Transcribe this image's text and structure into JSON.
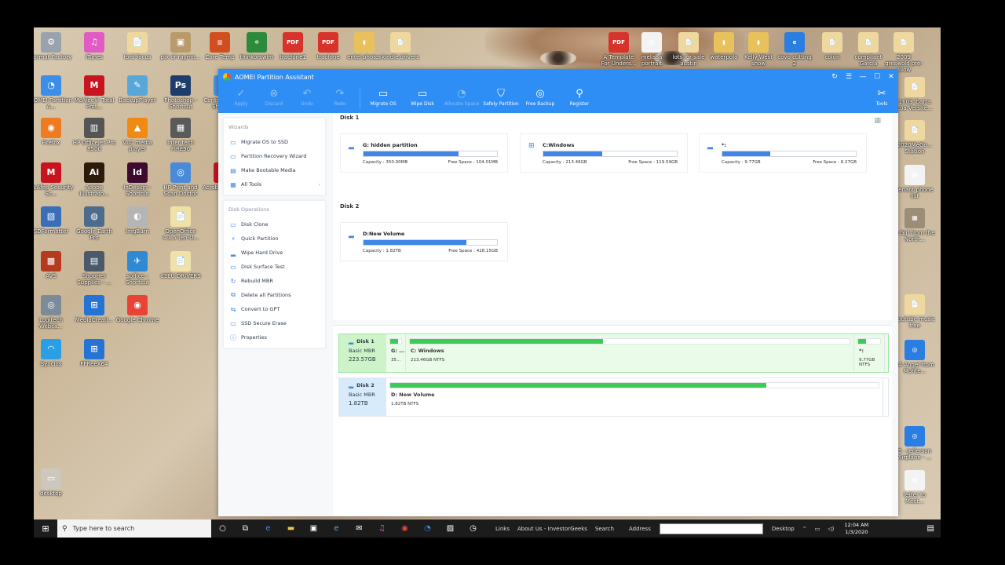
{
  "desktop": {
    "icons_left": [
      {
        "label": "Format Factory",
        "color": "#9aa3ad",
        "glyph": "⚙"
      },
      {
        "label": "iTunes",
        "color": "#e05bc3",
        "glyph": "♫"
      },
      {
        "label": "ford focus",
        "color": "#efd8a0",
        "glyph": "📄"
      },
      {
        "label": "pix of raymo...",
        "color": "#b99b6b",
        "glyph": "▣"
      },
      {
        "label": "AOMEI Partition A...",
        "color": "#3c8ee8",
        "glyph": "◔"
      },
      {
        "label": "McAfee® Total Prot...",
        "color": "#c8141e",
        "glyph": "M"
      },
      {
        "label": "BackupPlayer",
        "color": "#58a7d9",
        "glyph": "✎"
      },
      {
        "label": "Photoshop - Shortcut",
        "color": "#1d3d6d",
        "glyph": "Ps"
      },
      {
        "label": "Control Panel - Shortcut",
        "color": "#4a90d9",
        "glyph": "▤"
      },
      {
        "label": "Firefox",
        "color": "#ef7b21",
        "glyph": "◉"
      },
      {
        "label": "HP OfficeJet Pro 8500",
        "color": "#555",
        "glyph": "▥"
      },
      {
        "label": "VLC media player",
        "color": "#f08a12",
        "glyph": "▲"
      },
      {
        "label": "Inter-tech FIRE90",
        "color": "#5a5a5a",
        "glyph": "▦"
      },
      {
        "label": "McAfee Security Sc...",
        "color": "#c8141e",
        "glyph": "M"
      },
      {
        "label": "Adobe Illustrato...",
        "color": "#2c1a0a",
        "glyph": "Ai"
      },
      {
        "label": "InDesign - Shortcut",
        "color": "#3d0b2d",
        "glyph": "Id"
      },
      {
        "label": "HP Print and Scan Doctor",
        "color": "#4a8bd8",
        "glyph": "◎"
      },
      {
        "label": "Acrobat Reader DC",
        "color": "#c8141e",
        "glyph": "A"
      },
      {
        "label": "SDFormatter",
        "color": "#3a6fb8",
        "glyph": "▧"
      },
      {
        "label": "Google Earth Pro",
        "color": "#4d6c8d",
        "glyph": "◍"
      },
      {
        "label": "ImgBurn",
        "color": "#b5b5b5",
        "glyph": "◐"
      },
      {
        "label": "OpenOffice 4.1.5 (en-U...",
        "color": "#f0e1a8",
        "glyph": "📄"
      },
      {
        "label": "AVS",
        "color": "#b53a1e",
        "glyph": "▩"
      },
      {
        "label": "ShopHer Supplies - ...",
        "color": "#4b5a6a",
        "glyph": "▤"
      },
      {
        "label": "soffice - Shortcut",
        "color": "#2f8ad3",
        "glyph": "✈"
      },
      {
        "label": "d3EU DRIVERS",
        "color": "#f0e1a8",
        "glyph": "📄"
      },
      {
        "label": "Logitech Webca...",
        "color": "#7b8b99",
        "glyph": "◎"
      },
      {
        "label": "MediaCreati...",
        "color": "#2673d6",
        "glyph": "⊞"
      },
      {
        "label": "Google Chrome",
        "color": "#e94335",
        "glyph": "◉"
      },
      {
        "label": "Syncios",
        "color": "#2b9fe6",
        "glyph": "◠"
      },
      {
        "label": "FFReeX64",
        "color": "#2673d6",
        "glyph": "⊞"
      },
      {
        "label": "desktop",
        "color": "#cdc8bf",
        "glyph": "▭"
      }
    ],
    "icons_top": [
      {
        "label": "Core Temp",
        "color": "#d04e20",
        "glyph": "▥"
      },
      {
        "label": "thinkorswim",
        "color": "#2c8a3c",
        "glyph": "✲"
      },
      {
        "label": "tracfone1",
        "color": "#d7332b",
        "glyph": "PDF"
      },
      {
        "label": "tracfone",
        "color": "#d7332b",
        "glyph": "PDF"
      },
      {
        "label": "entei photos",
        "color": "#e8c15c",
        "glyph": "▮"
      },
      {
        "label": "kindle drivers",
        "color": "#efd8a0",
        "glyph": "📄"
      },
      {
        "label": "A Template For Unders...",
        "color": "#d7332b",
        "glyph": "PDF"
      },
      {
        "label": "melissa portrait",
        "color": "#f3f3f3",
        "glyph": "▥"
      },
      {
        "label": "lots for sale austin",
        "color": "#efd8a0",
        "glyph": "📄"
      },
      {
        "label": "waterpolo",
        "color": "#e8c15c",
        "glyph": "▮"
      },
      {
        "label": "Kelly West show",
        "color": "#e8c15c",
        "glyph": "▮"
      },
      {
        "label": "covo cutting 2",
        "color": "#2a7de1",
        "glyph": "e"
      },
      {
        "label": "colon",
        "color": "#efd8a0",
        "glyph": "📄"
      },
      {
        "label": "compliant Garcia",
        "color": "#efd8a0",
        "glyph": "📄"
      },
      {
        "label": "2009 greswold pre-allow",
        "color": "#efd8a0",
        "glyph": "📄"
      }
    ],
    "icons_right": [
      {
        "label": "1603 Ibarra coa Versite...",
        "color": "#efd8a0",
        "glyph": "📄"
      },
      {
        "label": "2020MeGo... Station",
        "color": "#efd8a0",
        "glyph": "📄"
      },
      {
        "label": "tenant phone list",
        "color": "#f3f3f3",
        "glyph": "▤"
      },
      {
        "label": "3 Girl from the North...",
        "color": "#9b8d78",
        "glyph": "▦"
      },
      {
        "label": "youtube music free",
        "color": "#efd8a0",
        "glyph": "📄"
      },
      {
        "label": "14 Angel from Monte...",
        "color": "#2a7de1",
        "glyph": "◎"
      },
      {
        "label": "5 - Jefferson Airplane - ...",
        "color": "#2a7de1",
        "glyph": "◎"
      },
      {
        "label": "letter to Meet...",
        "color": "#f3f3f3",
        "glyph": "▤"
      }
    ]
  },
  "app": {
    "title": "AOMEI Partition Assistant",
    "toolbar": [
      {
        "label": "Apply",
        "icon": "✓",
        "disabled": true
      },
      {
        "label": "Discard",
        "icon": "⊗",
        "disabled": true
      },
      {
        "label": "Undo",
        "icon": "↶",
        "disabled": true
      },
      {
        "label": "Redo",
        "icon": "↷",
        "disabled": true
      },
      {
        "label": "Migrate OS",
        "icon": "▭",
        "disabled": false
      },
      {
        "label": "Wipe Disk",
        "icon": "▭",
        "disabled": false
      },
      {
        "label": "Allocate Space",
        "icon": "◔",
        "disabled": true
      },
      {
        "label": "Safely Partition",
        "icon": "⛉",
        "disabled": false
      },
      {
        "label": "Free Backup",
        "icon": "◎",
        "disabled": false
      },
      {
        "label": "Register",
        "icon": "⚲",
        "disabled": false
      }
    ],
    "tools_label": "Tools",
    "wizards": {
      "header": "Wizards",
      "items": [
        {
          "label": "Migrate OS to SSD",
          "icon": "▭"
        },
        {
          "label": "Partition Recovery Wizard",
          "icon": "▭"
        },
        {
          "label": "Make Bootable Media",
          "icon": "▤"
        },
        {
          "label": "All Tools",
          "icon": "▦"
        }
      ]
    },
    "disk_operations": {
      "header": "Disk Operations",
      "items": [
        {
          "label": "Disk Clone",
          "icon": "▭"
        },
        {
          "label": "Quick Partition",
          "icon": "⚡"
        },
        {
          "label": "Wipe Hard Drive",
          "icon": "▂"
        },
        {
          "label": "Disk Surface Test",
          "icon": "▭"
        },
        {
          "label": "Rebuild MBR",
          "icon": "↻"
        },
        {
          "label": "Delete all Partitions",
          "icon": "⧉"
        },
        {
          "label": "Convert to GPT",
          "icon": "⇆"
        },
        {
          "label": "SSD Secure Erase",
          "icon": "▭"
        },
        {
          "label": "Properties",
          "icon": "ⓘ"
        }
      ]
    },
    "disk1": {
      "label": "Disk 1",
      "partitions": [
        {
          "name": "G: hidden partition",
          "capacity": "Capacity : 350.00MB",
          "free": "Free Space : 104.01MB",
          "used_fraction": 0.71,
          "icon": "▂"
        },
        {
          "name": "C:Windows",
          "capacity": "Capacity : 213.46GB",
          "free": "Free Space : 119.59GB",
          "used_fraction": 0.44,
          "icon": "⊞"
        },
        {
          "name": "*:",
          "capacity": "Capacity : 9.77GB",
          "free": "Free Space : 6.27GB",
          "used_fraction": 0.36,
          "icon": "▂"
        }
      ]
    },
    "disk2": {
      "label": "Disk 2",
      "partitions": [
        {
          "name": "D:New Volume",
          "capacity": "Capacity : 1.82TB",
          "free": "Free Space : 428.15GB",
          "used_fraction": 0.77,
          "icon": "▂"
        }
      ]
    },
    "map": [
      {
        "name": "Disk 1",
        "type": "Basic MBR",
        "size": "223.57GB",
        "selected": true,
        "blocks": [
          {
            "name": "G: ...",
            "info": "35...",
            "used_fraction": 0.71
          },
          {
            "name": "C: Windows",
            "info": "213.46GB NTFS",
            "used_fraction": 0.44
          },
          {
            "name": "*:",
            "info": "9.77GB NTFS",
            "used_fraction": 0.36
          }
        ]
      },
      {
        "name": "Disk 2",
        "type": "Basic MBR",
        "size": "1.82TB",
        "selected": false,
        "blocks": [
          {
            "name": "D: New Volume",
            "info": "1.82TB NTFS",
            "used_fraction": 0.77
          }
        ]
      }
    ]
  },
  "taskbar": {
    "search_placeholder": "Type here to search",
    "links_label": "Links",
    "link1": "About Us - InvestorGeeks",
    "link2": "Search",
    "address_label": "Address",
    "desktop_label": "Desktop",
    "time": "12:04 AM",
    "date": "1/3/2020"
  }
}
